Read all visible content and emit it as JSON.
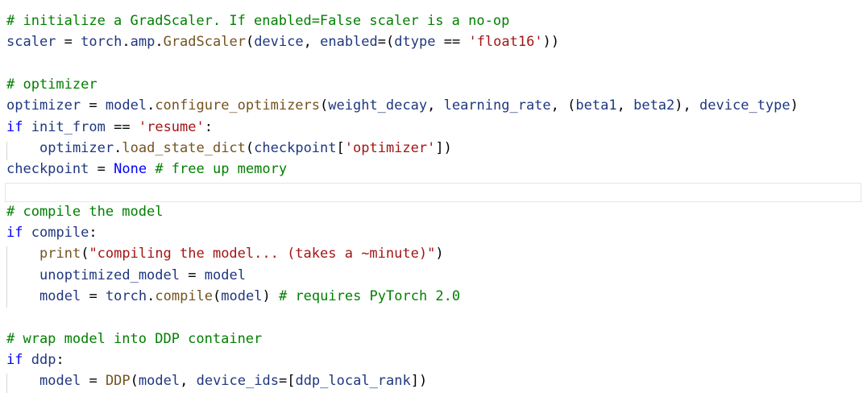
{
  "editor": {
    "lines": [
      "# initialize a GradScaler. If enabled=False scaler is a no-op",
      "scaler = torch.amp.GradScaler(device, enabled=(dtype == 'float16'))",
      "",
      "# optimizer",
      "optimizer = model.configure_optimizers(weight_decay, learning_rate, (beta1, beta2), device_type)",
      "if init_from == 'resume':",
      "    optimizer.load_state_dict(checkpoint['optimizer'])",
      "checkpoint = None # free up memory",
      "",
      "# compile the model",
      "if compile:",
      "    print(\"compiling the model... (takes a ~minute)\")",
      "    unoptimized_model = model",
      "    model = torch.compile(model) # requires PyTorch 2.0",
      "",
      "# wrap model into DDP container",
      "if ddp:",
      "    model = DDP(model, device_ids=[ddp_local_rank])"
    ]
  },
  "theme": {
    "comment_color": "#008000",
    "keyword_color": "#0000ff",
    "string_color": "#a31515",
    "identifier_color": "#1f377f",
    "function_color": "#74531f",
    "background": "#ffffff"
  }
}
